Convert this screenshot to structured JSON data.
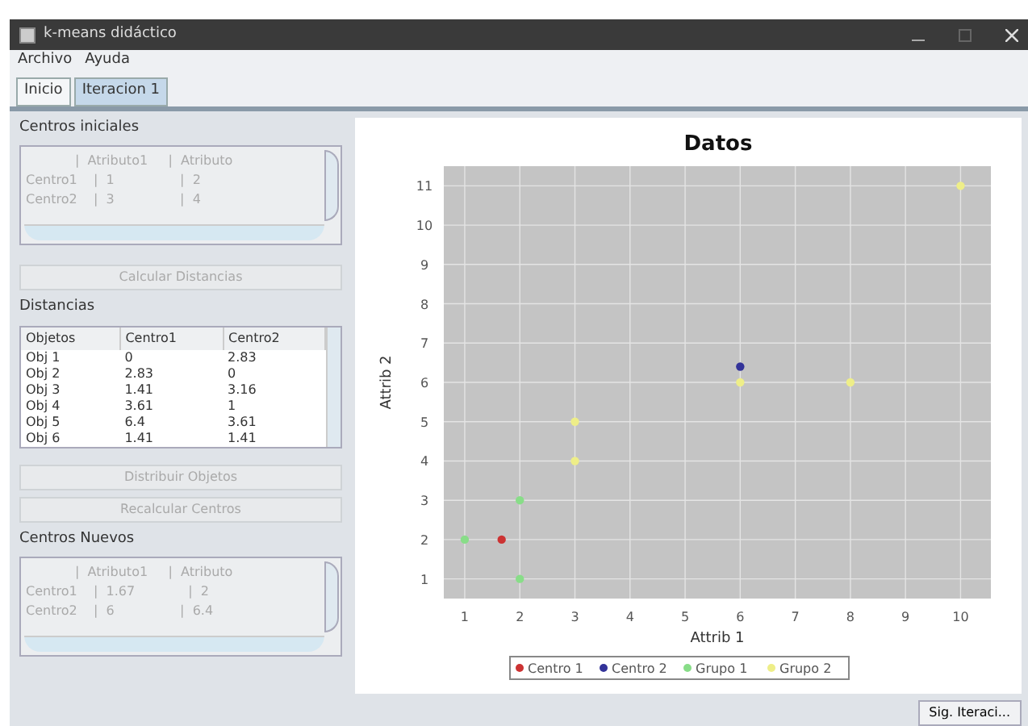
{
  "window": {
    "title": "k-means didáctico"
  },
  "menu": [
    "Archivo",
    "Ayuda"
  ],
  "tabs": [
    {
      "label": "Inicio",
      "selected": false
    },
    {
      "label": "Iteracion 1",
      "selected": true
    }
  ],
  "centros_iniciales": {
    "title": "Centros iniciales",
    "lines": [
      "            |  Atributo1     |  Atributo",
      "Centro1    |  1                |  2",
      "Centro2    |  3                |  4"
    ]
  },
  "buttons_top": [
    {
      "label": "Calcular Distancias",
      "disabled": true
    }
  ],
  "distancias": {
    "title": "Distancias",
    "columns": [
      "Objetos",
      "Centro1",
      "Centro2"
    ],
    "rows": [
      [
        "Obj 1",
        "0",
        "2.83"
      ],
      [
        "Obj 2",
        "2.83",
        "0"
      ],
      [
        "Obj 3",
        "1.41",
        "3.16"
      ],
      [
        "Obj 4",
        "3.61",
        "1"
      ],
      [
        "Obj 5",
        "6.4",
        "3.61"
      ],
      [
        "Obj 6",
        "1.41",
        "1.41"
      ]
    ]
  },
  "buttons_mid": [
    {
      "label": "Distribuir Objetos",
      "disabled": true
    },
    {
      "label": "Recalcular Centros",
      "disabled": true
    }
  ],
  "centros_nuevos": {
    "title": "Centros Nuevos",
    "lines": [
      "            |  Atributo1     |  Atributo",
      "Centro1    |  1.67             |  2",
      "Centro2    |  6                |  6.4"
    ]
  },
  "chart": {
    "chart_data": {
      "type": "scatter",
      "title": "Datos",
      "xlabel": "Attrib 1",
      "ylabel": "Attrib 2",
      "xlim": [
        0.62,
        10.55
      ],
      "ylim": [
        0.5,
        11.5
      ],
      "xticks": [
        1,
        2,
        3,
        4,
        5,
        6,
        7,
        8,
        9,
        10
      ],
      "yticks": [
        1,
        2,
        3,
        4,
        5,
        6,
        7,
        8,
        9,
        10,
        11
      ],
      "grid": true,
      "legend": "bottom",
      "series": [
        {
          "name": "Centro 1",
          "color": "#cc3333",
          "x": [
            1.67
          ],
          "values": [
            2
          ]
        },
        {
          "name": "Centro 2",
          "color": "#333399",
          "x": [
            6
          ],
          "values": [
            6.4
          ]
        },
        {
          "name": "Grupo 1",
          "color": "#88dd88",
          "x": [
            1,
            2,
            2
          ],
          "values": [
            2,
            1,
            3
          ]
        },
        {
          "name": "Grupo 2",
          "color": "#eeee88",
          "x": [
            3,
            3,
            6,
            8,
            10
          ],
          "values": [
            4,
            5,
            6,
            6,
            11
          ]
        }
      ]
    }
  },
  "next_button": {
    "label": "Sig. Iteraci..."
  }
}
